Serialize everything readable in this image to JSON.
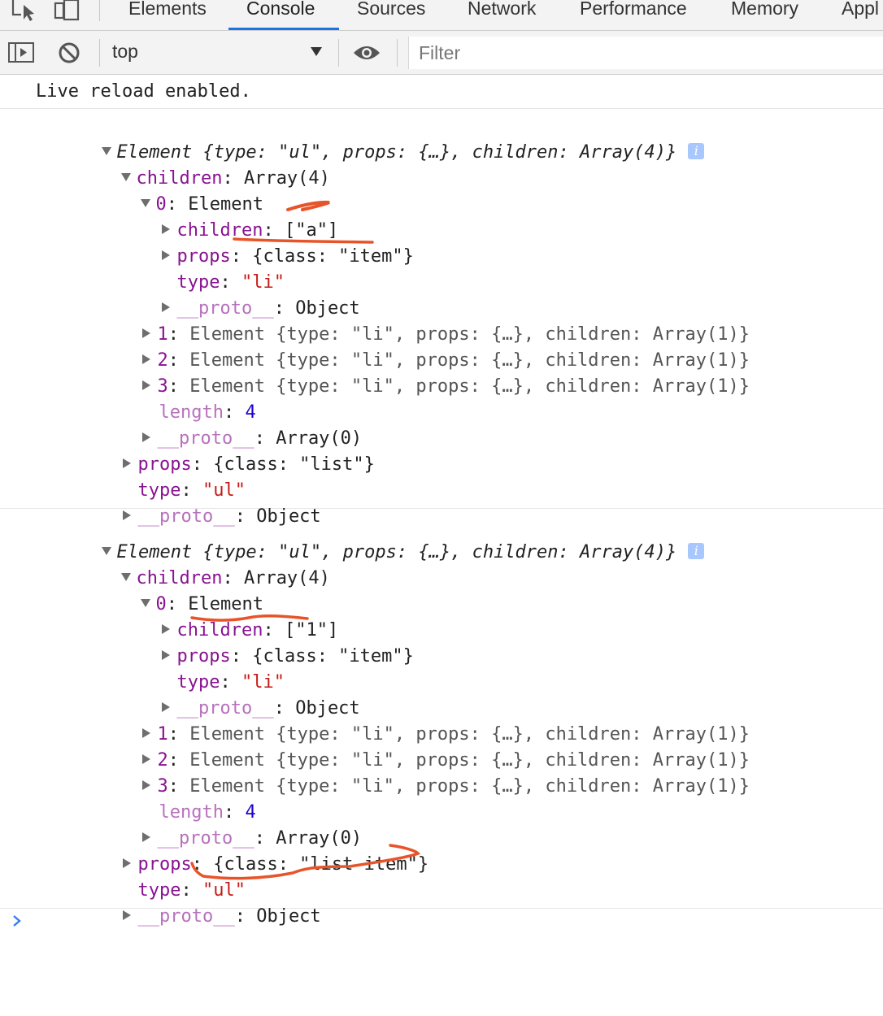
{
  "tabs": [
    "Elements",
    "Console",
    "Sources",
    "Network",
    "Performance",
    "Memory",
    "Appl"
  ],
  "active_tab": "Console",
  "toolbar": {
    "context": "top",
    "filter_placeholder": "Filter"
  },
  "console": {
    "log_message": "Live reload enabled.",
    "entry1": {
      "header_label": "Element",
      "header_summary": "{type: \"ul\", props: {…}, children: Array(4)}",
      "info_badge": "i",
      "children_key": "children",
      "children_value": "Array(4)",
      "item0_key": "0",
      "item0_value": "Element",
      "item0_children_key": "children",
      "item0_children_value": "[\"a\"]",
      "item0_props_key": "props",
      "item0_props_value": "{class: \"item\"}",
      "item0_type_key": "type",
      "item0_type_value": "\"li\"",
      "item0_proto_key": "__proto__",
      "item0_proto_value": "Object",
      "item1_key": "1",
      "item1_value": "Element {type: \"li\", props: {…}, children: Array(1)}",
      "item2_key": "2",
      "item2_value": "Element {type: \"li\", props: {…}, children: Array(1)}",
      "item3_key": "3",
      "item3_value": "Element {type: \"li\", props: {…}, children: Array(1)}",
      "length_key": "length",
      "length_value": "4",
      "arr_proto_key": "__proto__",
      "arr_proto_value": "Array(0)",
      "props_key": "props",
      "props_value": "{class: \"list\"}",
      "type_key": "type",
      "type_value": "\"ul\"",
      "proto_key": "__proto__",
      "proto_value": "Object"
    },
    "entry2": {
      "header_label": "Element",
      "header_summary": "{type: \"ul\", props: {…}, children: Array(4)}",
      "info_badge": "i",
      "children_key": "children",
      "children_value": "Array(4)",
      "item0_key": "0",
      "item0_value": "Element",
      "item0_children_key": "children",
      "item0_children_value": "[\"1\"]",
      "item0_props_key": "props",
      "item0_props_value": "{class: \"item\"}",
      "item0_type_key": "type",
      "item0_type_value": "\"li\"",
      "item0_proto_key": "__proto__",
      "item0_proto_value": "Object",
      "item1_key": "1",
      "item1_value": "Element {type: \"li\", props: {…}, children: Array(1)}",
      "item2_key": "2",
      "item2_value": "Element {type: \"li\", props: {…}, children: Array(1)}",
      "item3_key": "3",
      "item3_value": "Element {type: \"li\", props: {…}, children: Array(1)}",
      "length_key": "length",
      "length_value": "4",
      "arr_proto_key": "__proto__",
      "arr_proto_value": "Array(0)",
      "props_key": "props",
      "props_value": "{class: \"list-item\"}",
      "type_key": "type",
      "type_value": "\"ul\"",
      "proto_key": "__proto__",
      "proto_value": "Object"
    }
  },
  "colors": {
    "key": "#881391",
    "string": "#c41a16",
    "number": "#1c00cf",
    "accent_tab": "#1a73e8",
    "annotation": "#e8542a"
  },
  "icons": [
    "inspect-element-icon",
    "device-toolbar-icon",
    "sidebar-toggle-icon",
    "clear-console-icon",
    "dropdown-arrow-icon",
    "eye-icon",
    "info-icon",
    "console-prompt-icon"
  ]
}
